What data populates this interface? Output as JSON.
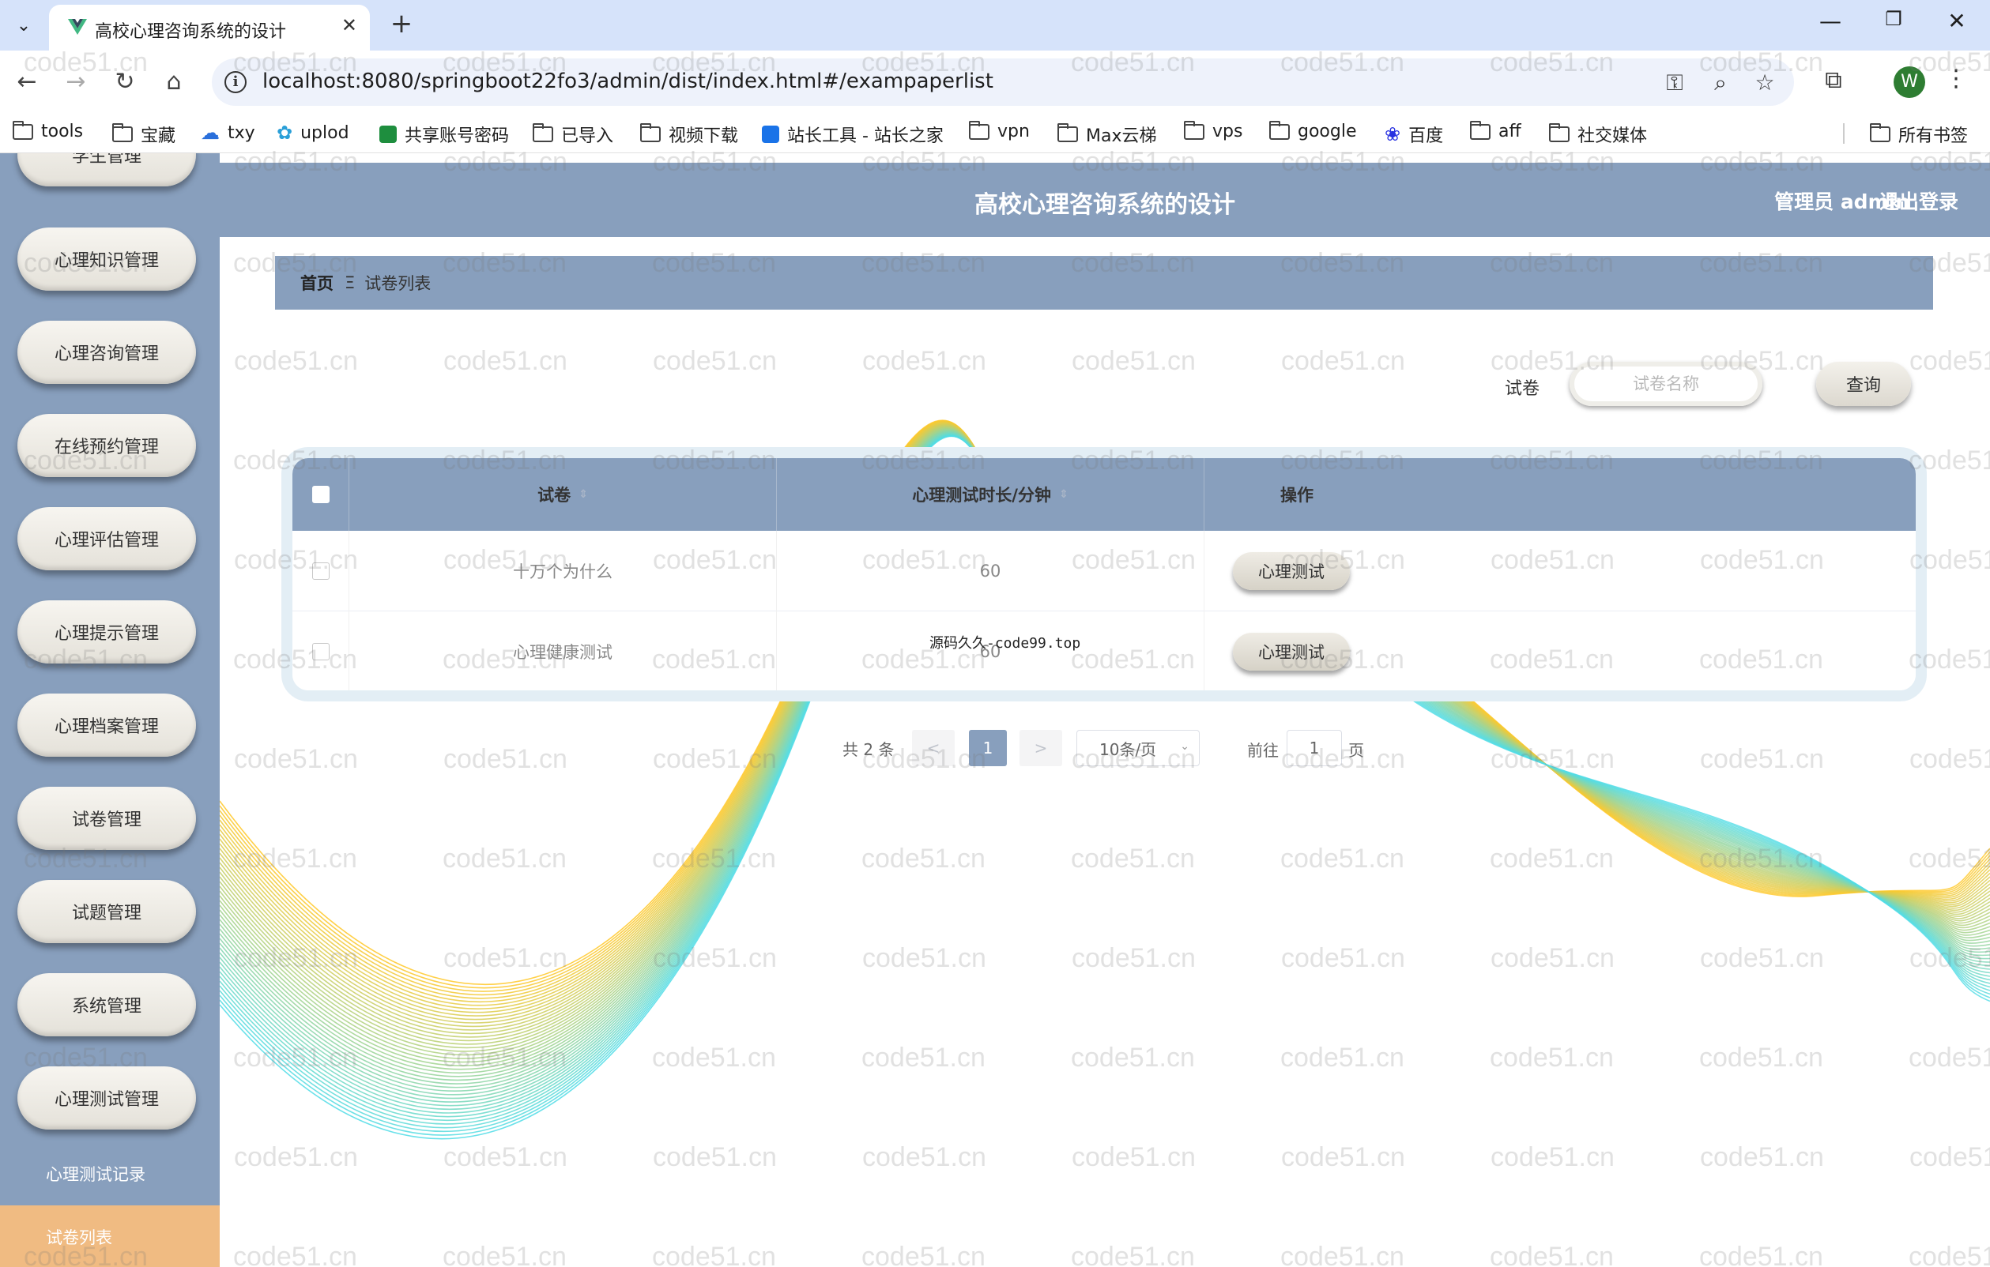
{
  "browser": {
    "tab_title": "高校心理咨询系统的设计",
    "url": "localhost:8080/springboot22fo3/admin/dist/index.html#/exampaperlist",
    "profile_initial": "W",
    "bookmarks": [
      "tools",
      "宝藏",
      "txy",
      "uplod",
      "共享账号密码",
      "已导入",
      "视频下载",
      "站长工具 - 站长之家",
      "vpn",
      "Max云梯",
      "vps",
      "google",
      "百度",
      "aff",
      "社交媒体"
    ],
    "all_bookmarks": "所有书签"
  },
  "header": {
    "title": "高校心理咨询系统的设计",
    "user": "管理员 admin",
    "logout": "退出登录"
  },
  "sidebar": {
    "partial_item": "学生管理",
    "items": [
      "心理知识管理",
      "心理咨询管理",
      "在线预约管理",
      "心理评估管理",
      "心理提示管理",
      "心理档案管理",
      "试卷管理",
      "试题管理",
      "系统管理",
      "心理测试管理"
    ],
    "sub_items": [
      "心理测试记录",
      "试卷列表"
    ],
    "active_sub": "试卷列表"
  },
  "breadcrumb": {
    "home": "首页",
    "separator": "Ξ",
    "current": "试卷列表"
  },
  "search": {
    "label": "试卷",
    "placeholder": "试卷名称",
    "button": "查询"
  },
  "table": {
    "columns": [
      "试卷",
      "心理测试时长/分钟",
      "操作"
    ],
    "rows": [
      {
        "name": "十万个为什么",
        "duration": "60",
        "action": "心理测试"
      },
      {
        "name": "心理健康测试",
        "duration": "60",
        "action": "心理测试"
      }
    ]
  },
  "source_note": "源码久久-code99.top",
  "pagination": {
    "total": "共 2 条",
    "prev": "<",
    "current_page": "1",
    "next": ">",
    "page_size": "10条/页",
    "goto_label": "前往",
    "goto_value": "1",
    "goto_unit": "页"
  },
  "watermark": "code51.cn",
  "colors": {
    "theme": "#889fbd",
    "active_sub": "#f0bb82",
    "tabbar": "#d6e3fa"
  }
}
